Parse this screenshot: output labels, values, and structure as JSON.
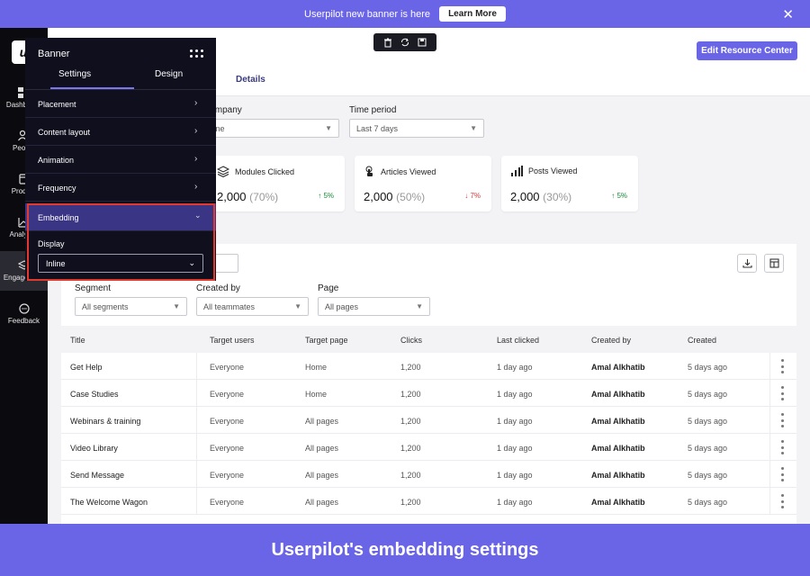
{
  "banner": {
    "text": "Userpilot new banner is here",
    "button": "Learn More"
  },
  "nav": {
    "logo": "u",
    "items": [
      {
        "label": "Dashboard",
        "icon": "dashboard-icon"
      },
      {
        "label": "People",
        "icon": "people-icon"
      },
      {
        "label": "Product",
        "icon": "product-icon"
      },
      {
        "label": "Analytics",
        "icon": "analytics-icon"
      },
      {
        "label": "Engagement",
        "icon": "layers-icon",
        "active": true
      },
      {
        "label": "Feedback",
        "icon": "chat-bubble-icon"
      }
    ]
  },
  "header": {
    "edit_button": "Edit Resource Center",
    "tab_details": "Details"
  },
  "filters_top": {
    "company": {
      "label": "Company",
      "value": "None"
    },
    "time_period": {
      "label": "Time period",
      "value": "Last 7 days"
    }
  },
  "stats": [
    {
      "label": "Modules Clicked",
      "value": "2,000",
      "pct": "(70%)",
      "delta": "5%",
      "dir": "up",
      "icon": "cube-stack-icon"
    },
    {
      "label": "Articles Viewed",
      "value": "2,000",
      "pct": "(50%)",
      "delta": "7%",
      "dir": "down",
      "icon": "touch-icon"
    },
    {
      "label": "Posts Viewed",
      "value": "2,000",
      "pct": "(30%)",
      "delta": "5%",
      "dir": "up",
      "icon": "bar-chart-icon"
    }
  ],
  "table_filters": {
    "segment": {
      "label": "Segment",
      "value": "All segments"
    },
    "created_by": {
      "label": "Created by",
      "value": "All teammates"
    },
    "page": {
      "label": "Page",
      "value": "All pages"
    }
  },
  "table": {
    "columns": [
      "Title",
      "Target users",
      "Target page",
      "Clicks",
      "Last clicked",
      "Created by",
      "Created"
    ],
    "rows": [
      [
        "Get Help",
        "Everyone",
        "Home",
        "1,200",
        "1 day ago",
        "Amal Alkhatib",
        "5 days ago"
      ],
      [
        "Case Studies",
        "Everyone",
        "Home",
        "1,200",
        "1 day ago",
        "Amal Alkhatib",
        "5 days ago"
      ],
      [
        "Webinars & training",
        "Everyone",
        "All pages",
        "1,200",
        "1 day ago",
        "Amal Alkhatib",
        "5 days ago"
      ],
      [
        "Video Library",
        "Everyone",
        "All pages",
        "1,200",
        "1 day ago",
        "Amal Alkhatib",
        "5 days ago"
      ],
      [
        "Send Message",
        "Everyone",
        "All pages",
        "1,200",
        "1 day ago",
        "Amal Alkhatib",
        "5 days ago"
      ],
      [
        "The Welcome Wagon",
        "Everyone",
        "All pages",
        "1,200",
        "1 day ago",
        "Amal Alkhatib",
        "5 days ago"
      ]
    ]
  },
  "panel": {
    "title": "Banner",
    "tabs": [
      "Settings",
      "Design"
    ],
    "rows": [
      "Placement",
      "Content layout",
      "Animation",
      "Frequency",
      "Embedding"
    ],
    "display_label": "Display",
    "display_value": "Inline"
  },
  "caption": "Userpilot's embedding settings",
  "colors": {
    "accent": "#6a64e6",
    "panel_bg": "#0f0f1e",
    "highlight": "#e23a2e",
    "up": "#1c8c3a",
    "down": "#d43c3c"
  }
}
